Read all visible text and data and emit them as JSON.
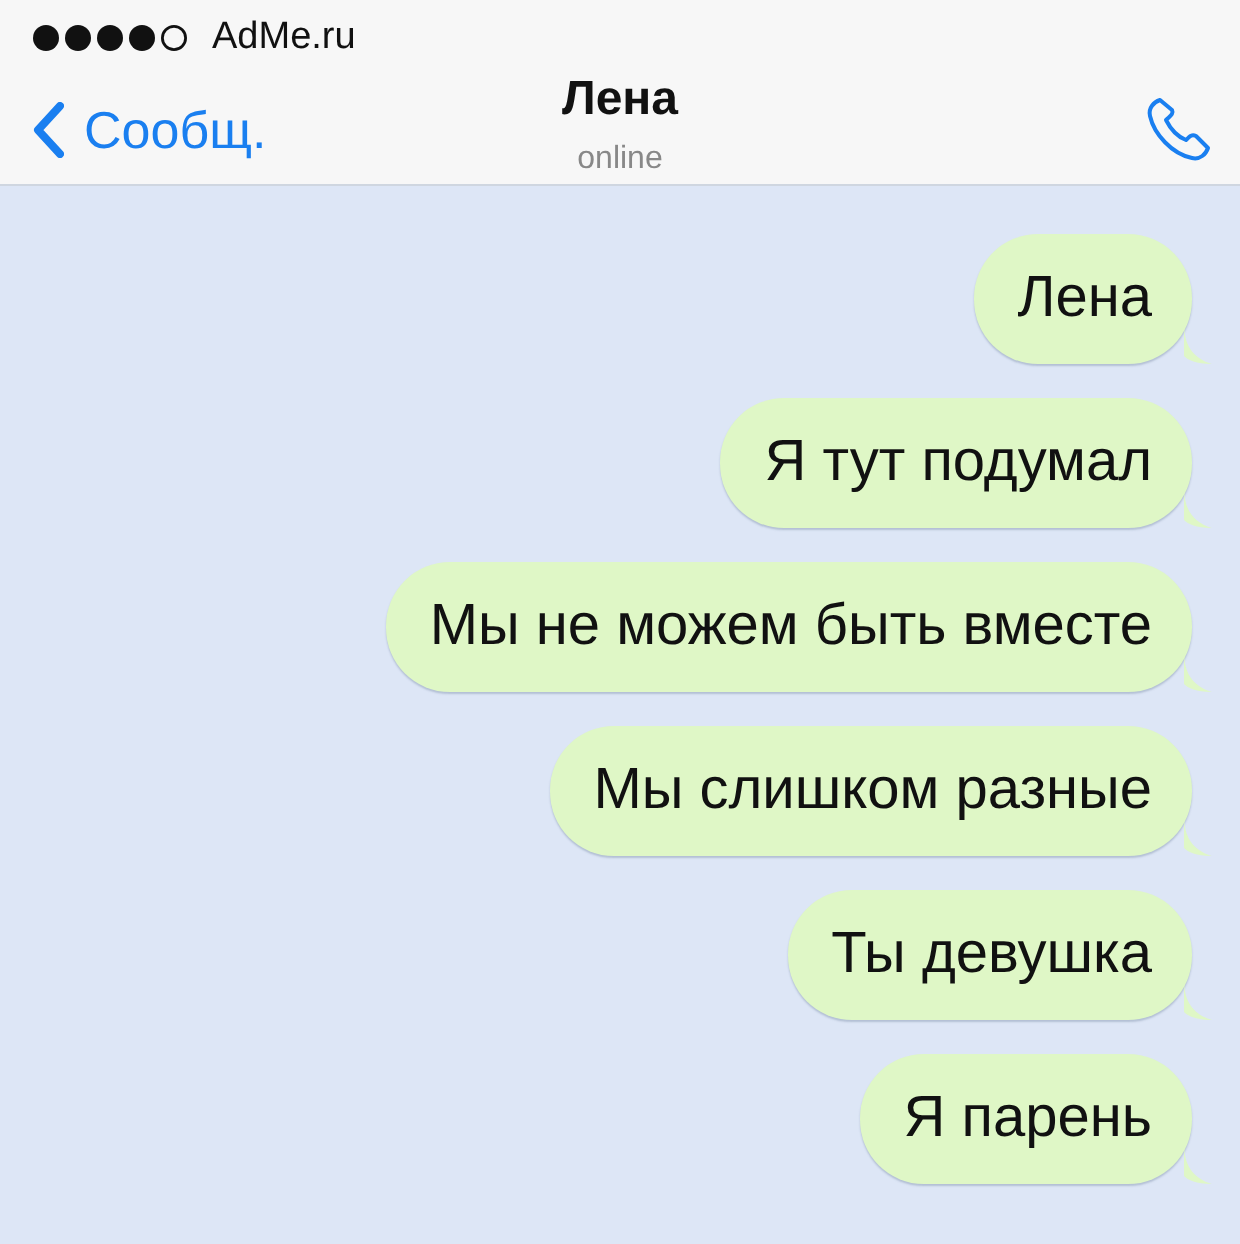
{
  "status_bar": {
    "carrier": "AdMe.ru"
  },
  "header": {
    "back_label": "Сообщ.",
    "title": "Лена",
    "subtitle": "online"
  },
  "messages": [
    {
      "text": "Лена",
      "outgoing": true
    },
    {
      "text": "Я тут подумал",
      "outgoing": true
    },
    {
      "text": "Мы не можем быть вместе",
      "outgoing": true
    },
    {
      "text": "Мы слишком разные",
      "outgoing": true
    },
    {
      "text": "Ты девушка",
      "outgoing": true
    },
    {
      "text": "Я парень",
      "outgoing": true
    }
  ]
}
